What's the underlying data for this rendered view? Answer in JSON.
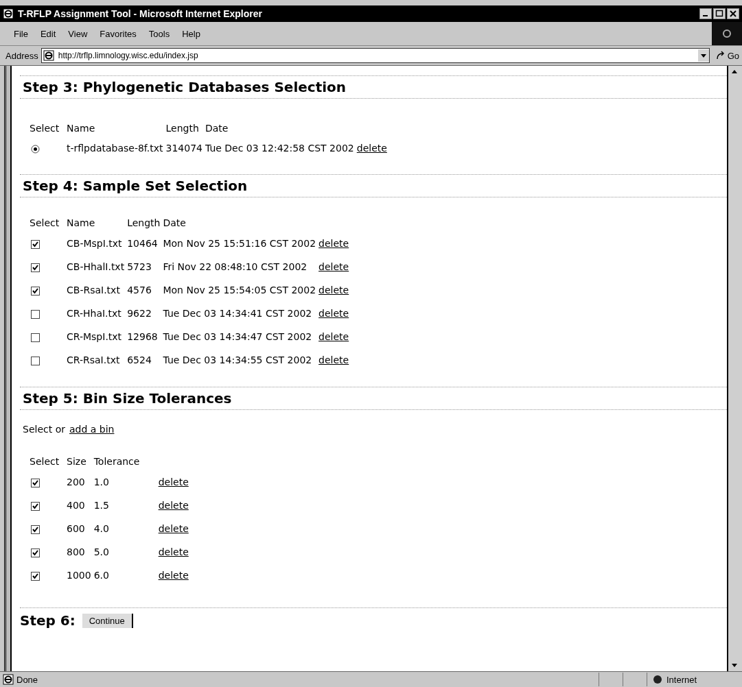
{
  "window": {
    "title": "T-RFLP Assignment Tool - Microsoft Internet Explorer"
  },
  "menu": [
    "File",
    "Edit",
    "View",
    "Favorites",
    "Tools",
    "Help"
  ],
  "address": {
    "label": "Address",
    "url": "http://trflp.limnology.wisc.edu/index.jsp",
    "go": "Go"
  },
  "step3": {
    "heading": "Step 3: Phylogenetic Databases Selection",
    "columns": [
      "Select",
      "Name",
      "Length",
      "Date"
    ],
    "rows": [
      {
        "selected": true,
        "name": "t-rflpdatabase-8f.txt",
        "length": "314074",
        "date": "Tue Dec 03 12:42:58 CST 2002",
        "action": "delete"
      }
    ]
  },
  "step4": {
    "heading": "Step 4: Sample Set Selection",
    "columns": [
      "Select",
      "Name",
      "Length",
      "Date"
    ],
    "rows": [
      {
        "checked": true,
        "name": "CB-MspI.txt",
        "length": "10464",
        "date": "Mon Nov 25 15:51:16 CST 2002",
        "action": "delete"
      },
      {
        "checked": true,
        "name": "CB-HhalI.txt",
        "length": "5723",
        "date": "Fri Nov 22 08:48:10 CST 2002",
        "action": "delete"
      },
      {
        "checked": true,
        "name": "CB-RsaI.txt",
        "length": "4576",
        "date": "Mon Nov 25 15:54:05 CST 2002",
        "action": "delete"
      },
      {
        "checked": false,
        "name": "CR-HhaI.txt",
        "length": "9622",
        "date": "Tue Dec 03 14:34:41 CST 2002",
        "action": "delete"
      },
      {
        "checked": false,
        "name": "CR-MspI.txt",
        "length": "12968",
        "date": "Tue Dec 03 14:34:47 CST 2002",
        "action": "delete"
      },
      {
        "checked": false,
        "name": "CR-RsaI.txt",
        "length": "6524",
        "date": "Tue Dec 03 14:34:55 CST 2002",
        "action": "delete"
      }
    ]
  },
  "step5": {
    "heading": "Step 5: Bin Size Tolerances",
    "intro": "Select or",
    "link": "add a bin",
    "columns": [
      "Select",
      "Size",
      "Tolerance"
    ],
    "rows": [
      {
        "checked": true,
        "size": "200",
        "tolerance": "1.0",
        "action": "delete"
      },
      {
        "checked": true,
        "size": "400",
        "tolerance": "1.5",
        "action": "delete"
      },
      {
        "checked": true,
        "size": "600",
        "tolerance": "4.0",
        "action": "delete"
      },
      {
        "checked": true,
        "size": "800",
        "tolerance": "5.0",
        "action": "delete"
      },
      {
        "checked": true,
        "size": "1000",
        "tolerance": "6.0",
        "action": "delete"
      }
    ]
  },
  "step6": {
    "heading": "Step 6:",
    "button": "Continue"
  },
  "status_bar": {
    "text": "Done",
    "zone": "Internet"
  }
}
